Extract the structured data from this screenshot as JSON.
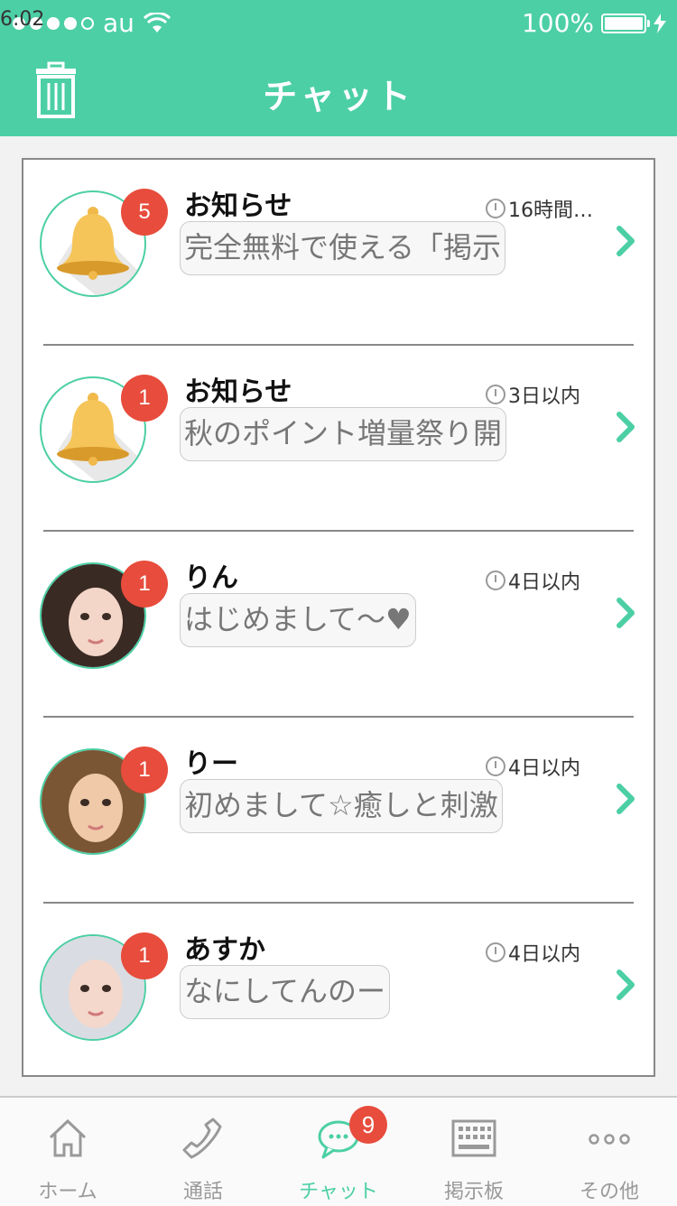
{
  "status": {
    "carrier": "au",
    "time": "6:02",
    "battery": "100%",
    "battery_level": 1.0
  },
  "header": {
    "title": "チャット"
  },
  "colors": {
    "accent": "#4ccfa5",
    "badge": "#e74c3c"
  },
  "chats": [
    {
      "name": "お知らせ",
      "time": "16時間…",
      "badge": "5",
      "preview": "完全無料で使える「掲示",
      "avatar": "bell-icon"
    },
    {
      "name": "お知らせ",
      "time": "3日以内",
      "badge": "1",
      "preview": "秋のポイント増量祭り開",
      "avatar": "bell-icon"
    },
    {
      "name": "りん",
      "time": "4日以内",
      "badge": "1",
      "preview": "はじめまして〜♥",
      "avatar": "user-photo"
    },
    {
      "name": "りー",
      "time": "4日以内",
      "badge": "1",
      "preview": "初めまして☆癒しと刺激",
      "avatar": "user-photo"
    },
    {
      "name": "あすか",
      "time": "4日以内",
      "badge": "1",
      "preview": "なにしてんのー",
      "avatar": "user-photo"
    }
  ],
  "tabs": [
    {
      "label": "ホーム",
      "icon": "home-icon"
    },
    {
      "label": "通話",
      "icon": "phone-icon"
    },
    {
      "label": "チャット",
      "icon": "chat-icon",
      "badge": "9",
      "active": true
    },
    {
      "label": "掲示板",
      "icon": "board-icon"
    },
    {
      "label": "その他",
      "icon": "more-icon"
    }
  ]
}
